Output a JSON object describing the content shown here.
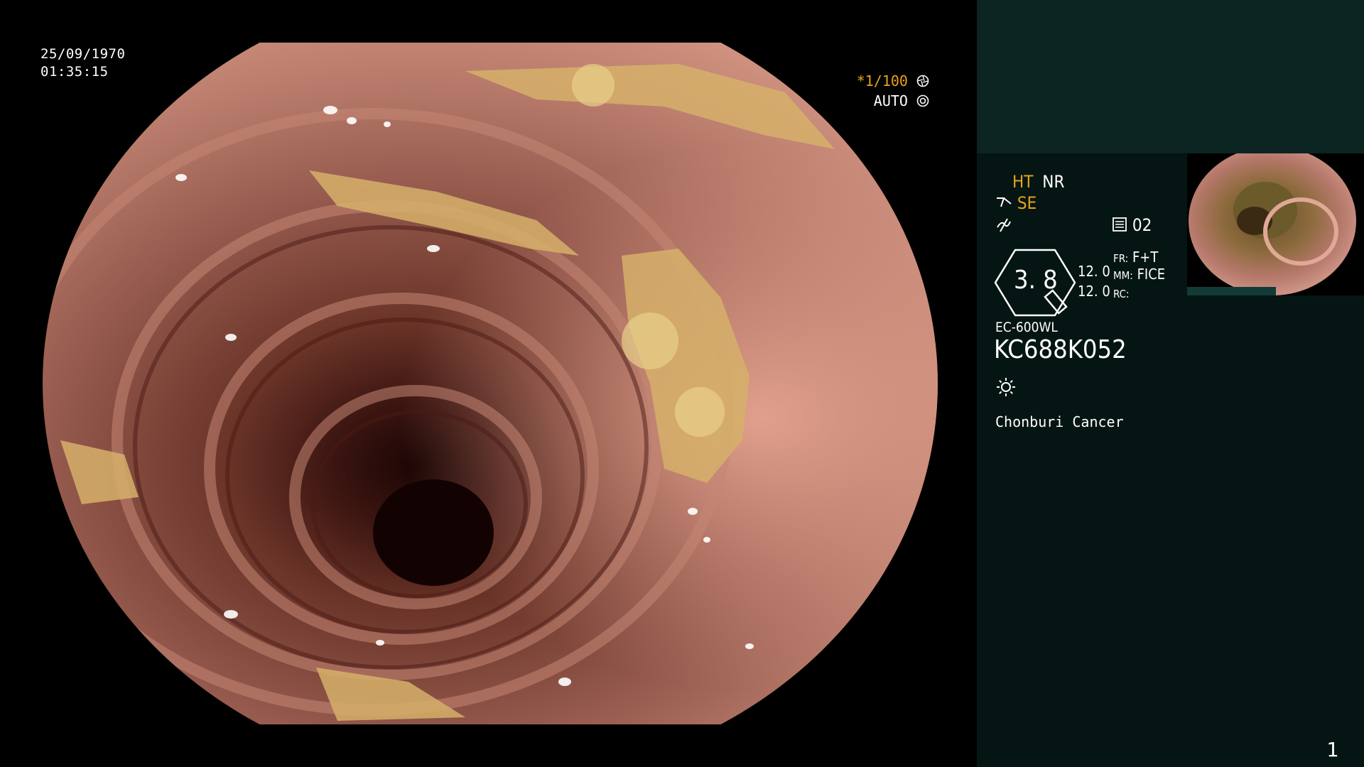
{
  "overlay": {
    "date": "25/09/1970",
    "time": "01:35:15",
    "shutter": "*1/100",
    "iris": "AUTO"
  },
  "panel": {
    "ht": "HT",
    "nr": "NR",
    "se": "SE",
    "memory": "02",
    "gauge_value": "3. 8",
    "val_top": "12. 0",
    "val_bottom": "12. 0",
    "fr_label": "FR:",
    "fr_value": "F+T",
    "mm_label": "MM:",
    "mm_value": "FICE",
    "rc_label": "RC:",
    "scope_model": "EC-600WL",
    "serial": "KC688K052",
    "institution": "Chonburi Cancer",
    "page": "1"
  },
  "colors": {
    "accent": "#e8a21a",
    "panel_bg": "#051513",
    "panel_top_bg": "#0c2422"
  },
  "icons": [
    "shutter-icon",
    "iris-icon",
    "scissor-icon",
    "wave-icon",
    "memory-icon",
    "light-icon"
  ]
}
